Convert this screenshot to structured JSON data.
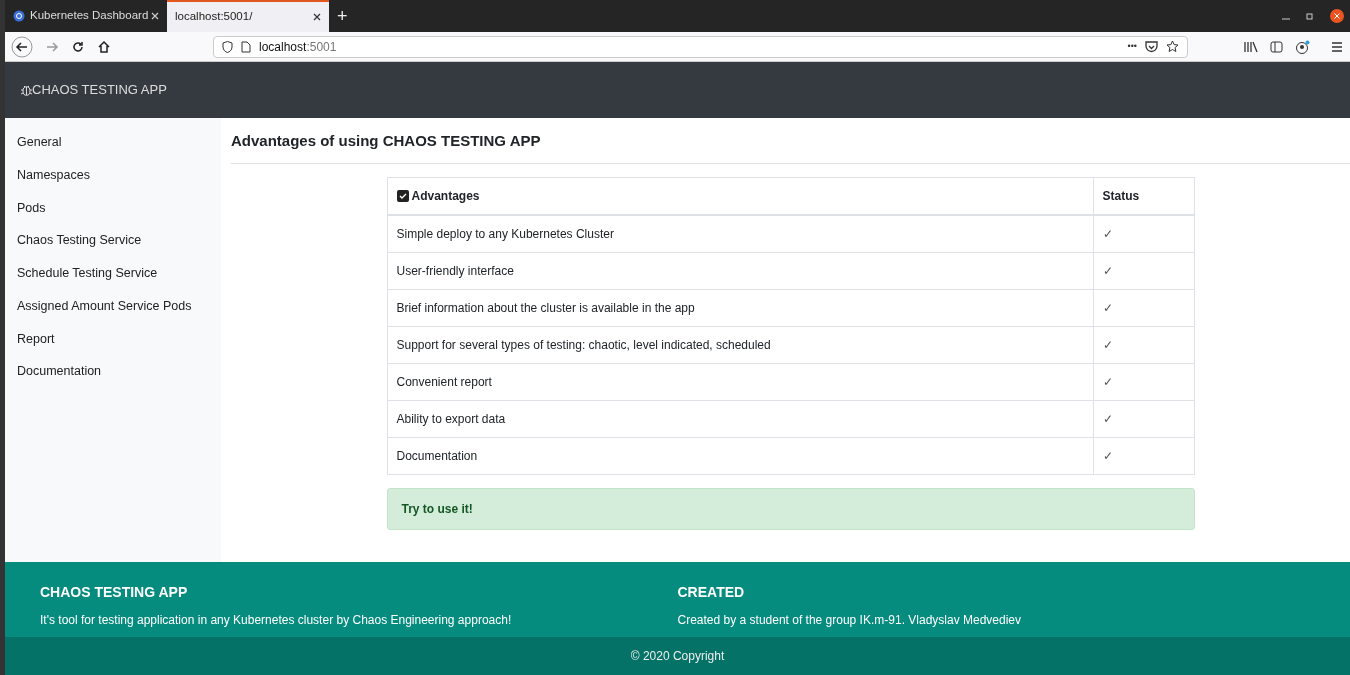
{
  "browser": {
    "tabs": [
      {
        "label": "Kubernetes Dashboard",
        "selected": false
      },
      {
        "label": "localhost:5001/",
        "selected": true
      }
    ],
    "new_tab": "+",
    "url_host": "localhost",
    "url_port": ":5001",
    "more": "•••"
  },
  "app": {
    "brand": "CHAOS TESTING APP"
  },
  "sidebar": {
    "items": [
      "General",
      "Namespaces",
      "Pods",
      "Chaos Testing Service",
      "Schedule Testing Service",
      "Assigned Amount Service Pods",
      "Report",
      "Documentation"
    ]
  },
  "page_title": "Advantages of using CHAOS TESTING APP",
  "table": {
    "columns": [
      "Advantages",
      "Status"
    ],
    "header_checked": true,
    "rows": [
      {
        "text": "Simple deploy to any Kubernetes Cluster",
        "status": "✓"
      },
      {
        "text": "User-friendly interface",
        "status": "✓"
      },
      {
        "text": "Brief information about the cluster is available in the app",
        "status": "✓"
      },
      {
        "text": "Support for several types of testing: chaotic, level indicated, scheduled",
        "status": "✓"
      },
      {
        "text": "Convenient report",
        "status": "✓"
      },
      {
        "text": "Ability to export data",
        "status": "✓"
      },
      {
        "text": "Documentation",
        "status": "✓"
      }
    ]
  },
  "alert": "Try to use it!",
  "footer": {
    "left_title": "CHAOS TESTING APP",
    "left_text": "It's tool for testing application in any Kubernetes cluster by Chaos Engineering approach!",
    "right_title": "CREATED",
    "right_text": "Created by a student of the group IK.m-91. Vladyslav Medvediev",
    "copyright": "© 2020 Copyright"
  }
}
